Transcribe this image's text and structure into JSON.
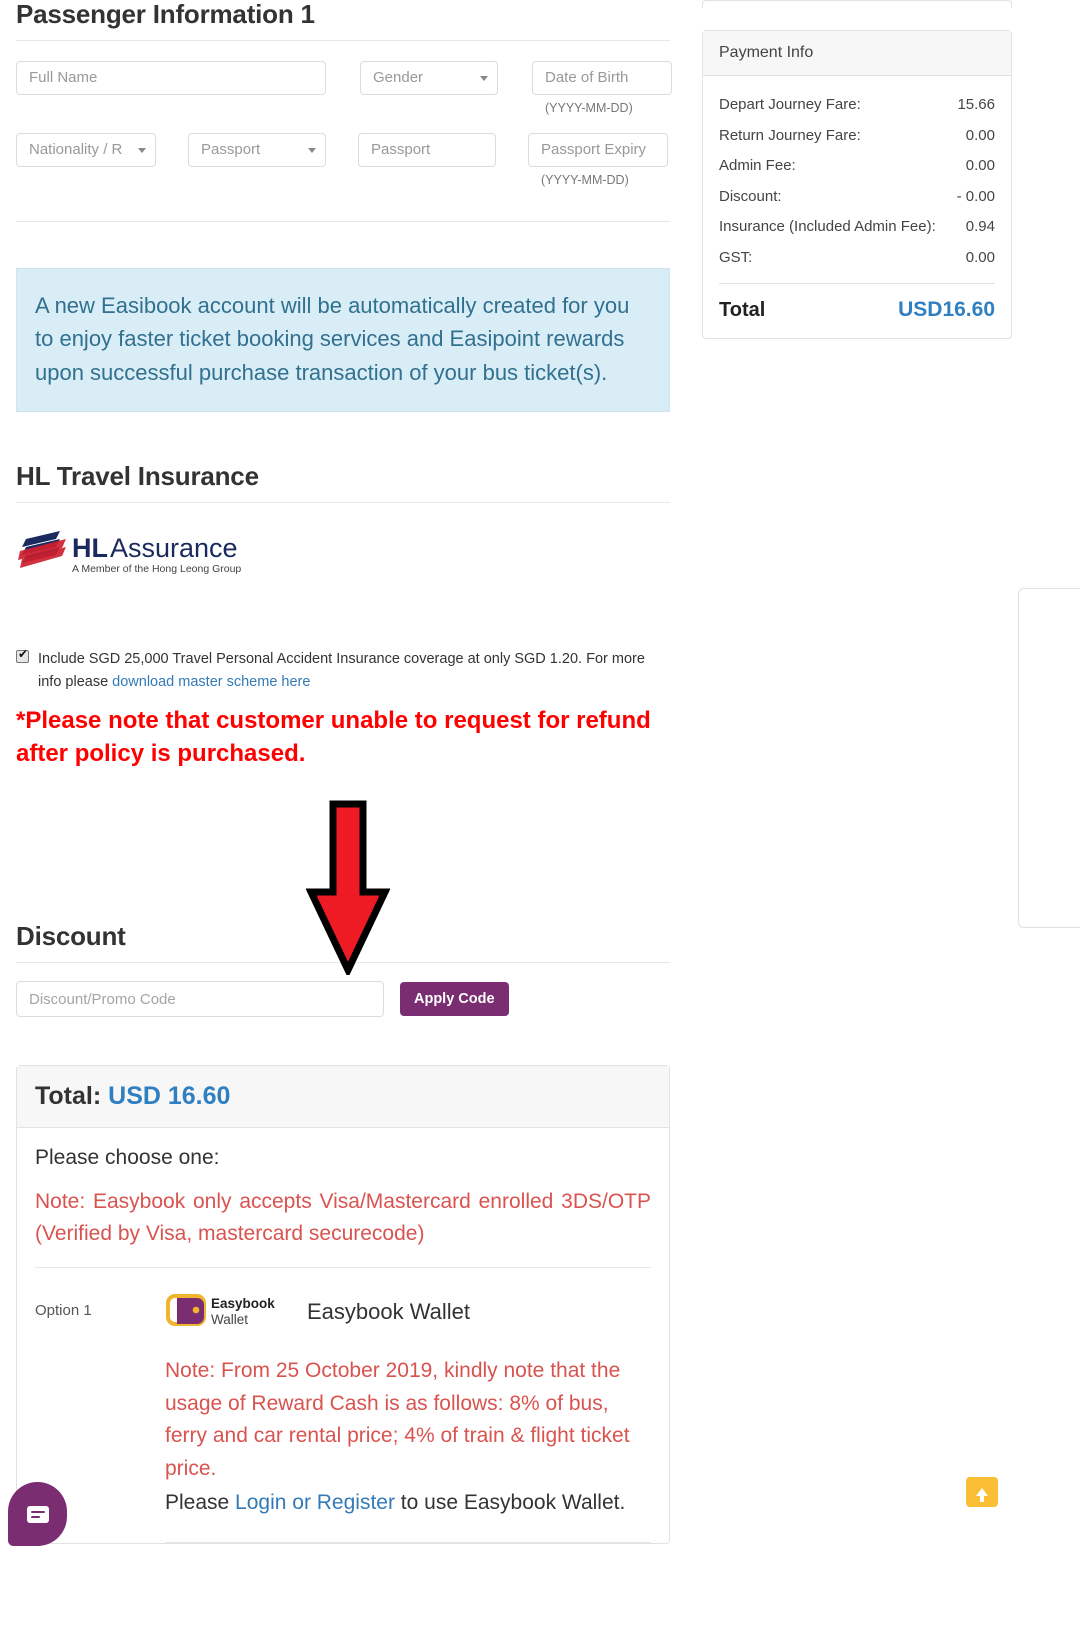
{
  "passenger": {
    "title": "Passenger Information 1",
    "fields": {
      "full_name_placeholder": "Full Name",
      "gender_placeholder": "Gender",
      "dob_placeholder": "Date of Birth",
      "dob_hint": "(YYYY-MM-DD)",
      "nationality_placeholder": "Nationality / R",
      "passport_type_placeholder": "Passport",
      "passport_number_placeholder": "Passport",
      "passport_expiry_placeholder": "Passport Expiry",
      "passport_expiry_hint": "(YYYY-MM-DD)"
    }
  },
  "account_notice": "A new Easibook account will be automatically created for you to enjoy faster ticket booking services and Easipoint rewards upon successful purchase transaction of your bus ticket(s).",
  "insurance": {
    "title": "HL Travel Insurance",
    "logo_brand_bold": "HL",
    "logo_brand_light": "Assurance",
    "logo_tagline": "A Member of the Hong Leong Group",
    "checkbox_text_before": "Include SGD 25,000 Travel Personal Accident Insurance coverage at only SGD 1.20. For more info please ",
    "checkbox_link": "download master scheme here",
    "checkbox_checked": true,
    "refund_warning": "*Please note that customer unable to request for refund after policy is purchased."
  },
  "discount": {
    "title": "Discount",
    "input_placeholder": "Discount/Promo Code",
    "input_value": "",
    "apply_label": "Apply Code"
  },
  "total_panel": {
    "total_label": "Total:",
    "total_amount": "USD 16.60",
    "choose_label": "Please choose one:",
    "card_note": "Note: Easybook only accepts Visa/Mastercard enrolled 3DS/OTP (Verified by Visa, mastercard securecode)",
    "option_1": {
      "option_label": "Option 1",
      "logo_line1": "Easybook",
      "logo_line2": "Wallet",
      "name": "Easybook Wallet",
      "reward_note": "Note: From 25 October 2019, kindly note that the usage of Reward Cash is as follows: 8% of bus, ferry and car rental price; 4% of train & flight ticket price.",
      "login_prefix": "Please ",
      "login_link": "Login or Register",
      "login_suffix": " to use Easybook Wallet."
    }
  },
  "payment_info": {
    "header": "Payment Info",
    "rows": [
      {
        "label": "Depart Journey Fare:",
        "value": "15.66"
      },
      {
        "label": "Return Journey Fare:",
        "value": "0.00"
      },
      {
        "label": "Admin Fee:",
        "value": "0.00"
      },
      {
        "label": "Discount:",
        "value": "- 0.00"
      },
      {
        "label": "Insurance (Included Admin Fee):",
        "value": "0.94"
      },
      {
        "label": "GST:",
        "value": "0.00"
      }
    ],
    "total_label": "Total",
    "total_value": "USD16.60"
  },
  "widgets": {
    "chat_icon": "chat-icon",
    "scroll_top_icon": "arrow-up-icon",
    "annotation_arrow": "red-down-arrow"
  },
  "colors": {
    "accent_purple": "#7b2d72",
    "link_blue": "#337ab7",
    "total_blue": "#2f7fc1",
    "warning_red": "#ff0000",
    "note_red": "#d9534f",
    "info_bg": "#d9edf7",
    "info_text": "#31708f",
    "scroll_top_yellow": "#fbbe35"
  }
}
